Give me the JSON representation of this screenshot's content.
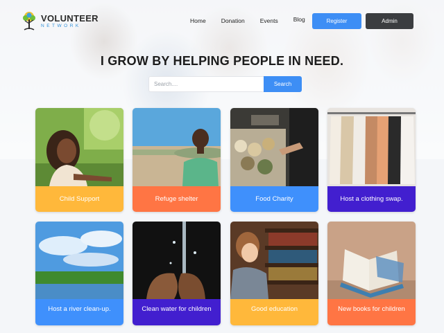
{
  "logo": {
    "title": "VOLUNTEER",
    "subtitle": "NETWORK"
  },
  "nav": {
    "links": [
      "Home",
      "Donation",
      "Events",
      "Blog"
    ]
  },
  "buttons": {
    "register": "Register",
    "admin": "Admin"
  },
  "hero": {
    "headline": "I GROW BY HELPING PEOPLE IN NEED."
  },
  "search": {
    "placeholder": "Search....",
    "button": "Search"
  },
  "cards": [
    {
      "label": "Child Support",
      "color": "#ffb83b"
    },
    {
      "label": "Refuge shelter",
      "color": "#ff7544"
    },
    {
      "label": "Food Charity",
      "color": "#3f90fc"
    },
    {
      "label": "Host a clothing swap.",
      "color": "#421fcf"
    },
    {
      "label": "Host a river clean-up.",
      "color": "#3f90fc"
    },
    {
      "label": "Clean water for children",
      "color": "#421fcf"
    },
    {
      "label": "Good education",
      "color": "#ffb83b"
    },
    {
      "label": "New books for children",
      "color": "#ff7544"
    }
  ]
}
